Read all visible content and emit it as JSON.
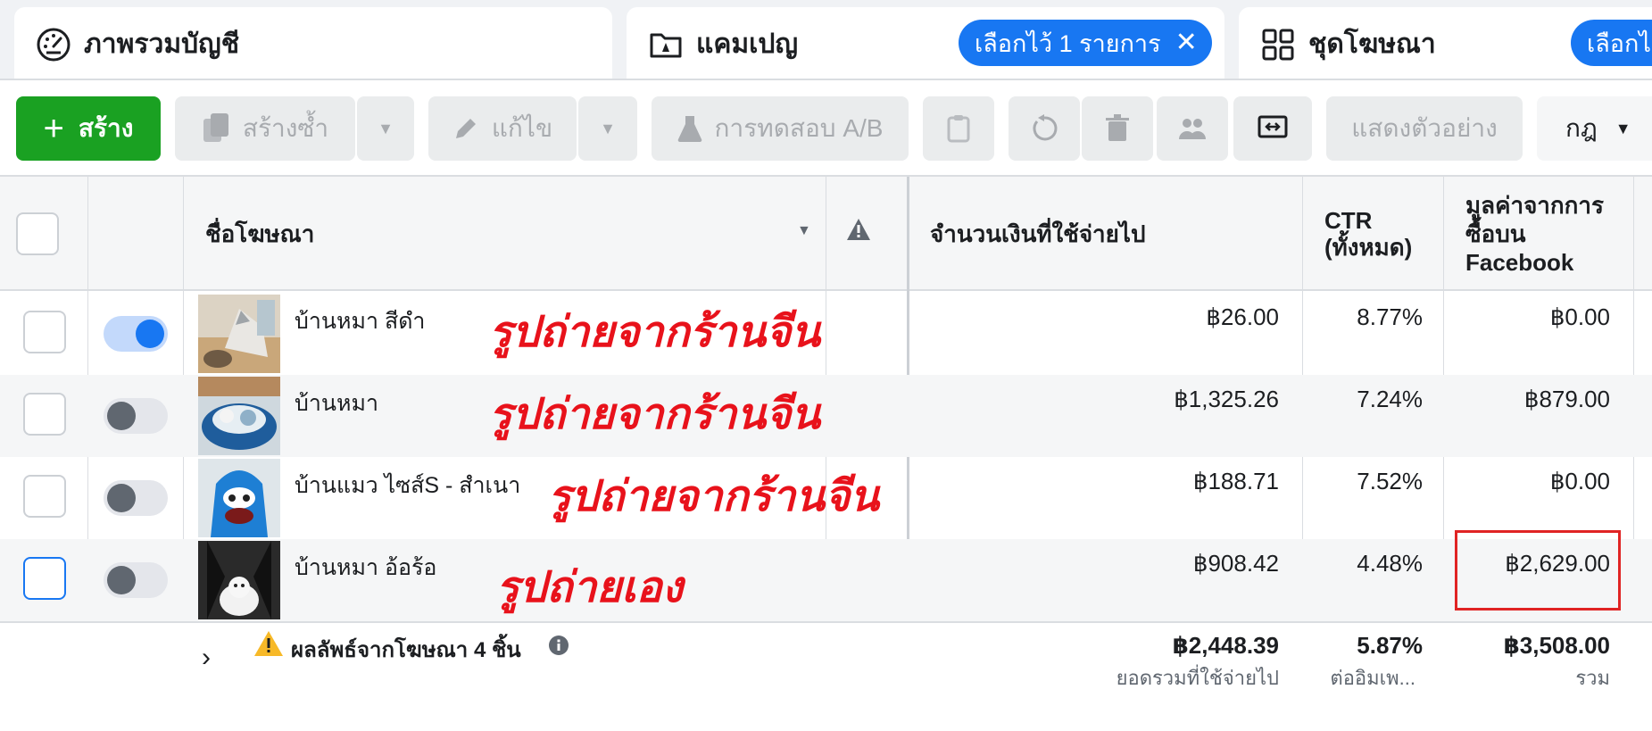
{
  "tabs": [
    {
      "label": "ภาพรวมบัญชี",
      "icon": "speedometer-icon"
    },
    {
      "label": "แคมเปญ",
      "icon": "folder-icon",
      "pill": "เลือกไว้ 1 รายการ"
    },
    {
      "label": "ชุดโฆษณา",
      "icon": "grid-icon",
      "pill": "เลือกไว้"
    }
  ],
  "toolbar": {
    "create": "สร้าง",
    "duplicate": "สร้างซ้ำ",
    "edit": "แก้ไข",
    "ab_test": "การทดสอบ A/B",
    "preview": "แสดงตัวอย่าง",
    "rules": "กฎ"
  },
  "columns": {
    "name": "ชื่อโฆษณา",
    "spent": "จำนวนเงินที่ใช้จ่ายไป",
    "ctr_line1": "CTR",
    "ctr_line2": "(ทั้งหมด)",
    "value_line1": "มูลค่าจากการ",
    "value_line2": "ซื้อบน",
    "value_line3": "Facebook"
  },
  "rows": [
    {
      "name": "บ้านหมา สีดำ",
      "note": "รูปถ่ายจากร้านจีน",
      "spent": "฿26.00",
      "ctr": "8.77%",
      "value": "฿0.00",
      "active": true
    },
    {
      "name": "บ้านหมา",
      "note": "รูปถ่ายจากร้านจีน",
      "spent": "฿1,325.26",
      "ctr": "7.24%",
      "value": "฿879.00",
      "active": false
    },
    {
      "name": "บ้านแมว ไซส์S - สำเนา",
      "note": "รูปถ่ายจากร้านจีน",
      "spent": "฿188.71",
      "ctr": "7.52%",
      "value": "฿0.00",
      "active": false
    },
    {
      "name": "บ้านหมา อ้อร้อ",
      "note": "รูปถ่ายเอง",
      "spent": "฿908.42",
      "ctr": "4.48%",
      "value": "฿2,629.00",
      "active": false
    }
  ],
  "summary": {
    "label": "ผลลัพธ์จากโฆษณา 4 ชิ้น",
    "spent": "฿2,448.39",
    "spent_sub": "ยอดรวมที่ใช้จ่ายไป",
    "ctr": "5.87%",
    "ctr_sub": "ต่ออิมเพ...",
    "value": "฿3,508.00",
    "value_sub": "รวม"
  },
  "colors": {
    "accent": "#1877f2",
    "create": "#1aa122",
    "annotation": "#e8121b"
  }
}
